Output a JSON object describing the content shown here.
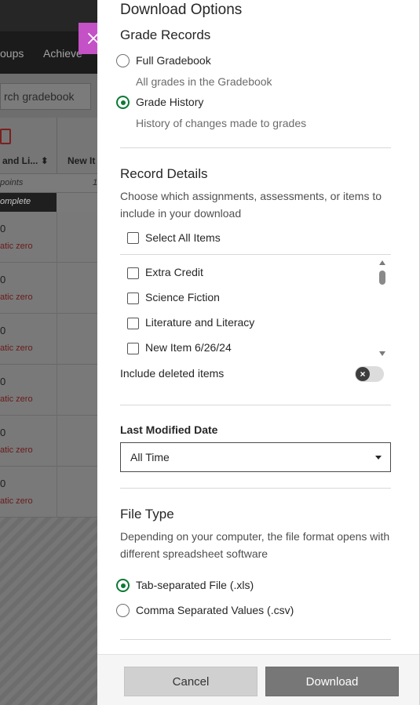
{
  "background": {
    "nav_items": [
      "oups",
      "Achieve"
    ],
    "search_placeholder": "rch gradebook",
    "col1_header": "and Li...",
    "col1_sort_icon": "sort-icon",
    "col2_header": "New It",
    "points_label": "points",
    "points_value": "1",
    "complete_label": "omplete",
    "rows": [
      {
        "value": "0",
        "note": "atic zero"
      },
      {
        "value": "0",
        "note": "atic zero"
      },
      {
        "value": "0",
        "note": "atic zero"
      },
      {
        "value": "0",
        "note": "atic zero"
      },
      {
        "value": "0",
        "note": "atic zero"
      },
      {
        "value": "0",
        "note": "atic zero"
      }
    ]
  },
  "close_icon": "close-icon",
  "panel": {
    "title": "Download Options",
    "grade_records": {
      "heading": "Grade Records",
      "options": [
        {
          "label": "Full Gradebook",
          "description": "All grades in the Gradebook",
          "selected": false
        },
        {
          "label": "Grade History",
          "description": "History of changes made to grades",
          "selected": true
        }
      ]
    },
    "record_details": {
      "heading": "Record Details",
      "help": "Choose which assignments, assessments, or items to include in your download",
      "select_all": "Select All Items",
      "items": [
        "Extra Credit",
        "Science Fiction",
        "Literature and Literacy",
        "New Item 6/26/24"
      ],
      "include_deleted": "Include deleted items",
      "include_deleted_on": false
    },
    "last_modified": {
      "heading": "Last Modified Date",
      "selected": "All Time"
    },
    "file_type": {
      "heading": "File Type",
      "help": "Depending on your computer, the file format opens with different spreadsheet software",
      "options": [
        {
          "label": "Tab-separated File (.xls)",
          "selected": true
        },
        {
          "label": "Comma Separated Values (.csv)",
          "selected": false
        }
      ]
    },
    "footer": {
      "cancel": "Cancel",
      "download": "Download"
    }
  },
  "colors": {
    "accent_green": "#0b7a34",
    "close_button": "#c452c6",
    "error_red": "#6b1a1a"
  }
}
